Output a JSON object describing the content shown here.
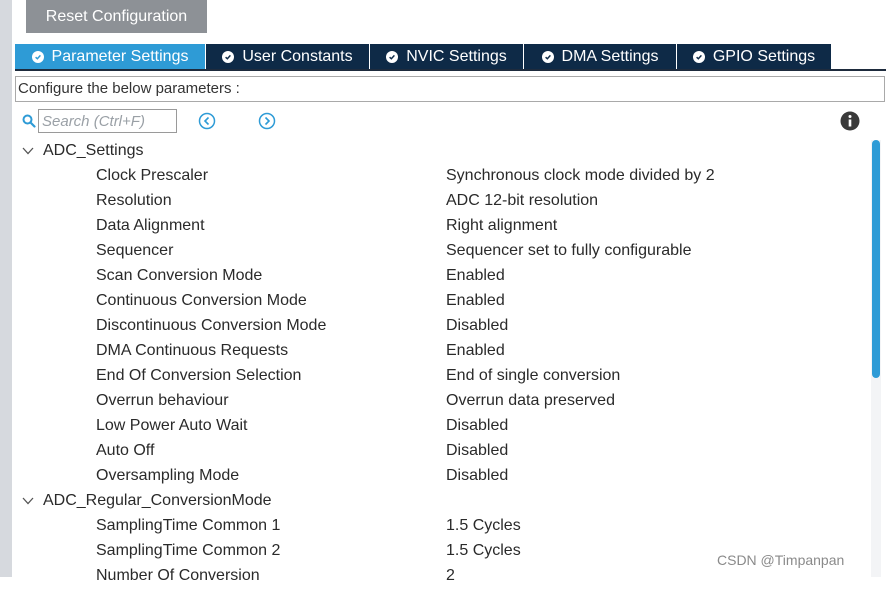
{
  "toolbar": {
    "reset_label": "Reset Configuration"
  },
  "tabs": [
    {
      "label": "Parameter Settings",
      "active": true
    },
    {
      "label": "User Constants",
      "active": false
    },
    {
      "label": "NVIC Settings",
      "active": false
    },
    {
      "label": "DMA Settings",
      "active": false
    },
    {
      "label": "GPIO Settings",
      "active": false
    }
  ],
  "caption": "Configure the below parameters :",
  "search": {
    "placeholder": "Search (Ctrl+F)"
  },
  "groups": [
    {
      "label": "ADC_Settings",
      "params": [
        {
          "name": "Clock Prescaler",
          "value": "Synchronous clock mode divided by 2"
        },
        {
          "name": "Resolution",
          "value": "ADC 12-bit resolution"
        },
        {
          "name": "Data Alignment",
          "value": "Right alignment"
        },
        {
          "name": "Sequencer",
          "value": "Sequencer set to fully configurable"
        },
        {
          "name": "Scan Conversion Mode",
          "value": "Enabled"
        },
        {
          "name": "Continuous Conversion Mode",
          "value": "Enabled"
        },
        {
          "name": "Discontinuous Conversion Mode",
          "value": "Disabled"
        },
        {
          "name": "DMA Continuous Requests",
          "value": "Enabled"
        },
        {
          "name": "End Of Conversion Selection",
          "value": "End of single conversion"
        },
        {
          "name": "Overrun behaviour",
          "value": "Overrun data preserved"
        },
        {
          "name": "Low Power Auto Wait",
          "value": "Disabled"
        },
        {
          "name": "Auto Off",
          "value": "Disabled"
        },
        {
          "name": "Oversampling Mode",
          "value": "Disabled"
        }
      ]
    },
    {
      "label": "ADC_Regular_ConversionMode",
      "params": [
        {
          "name": "SamplingTime Common 1",
          "value": "1.5 Cycles"
        },
        {
          "name": "SamplingTime Common 2",
          "value": "1.5 Cycles"
        },
        {
          "name": "Number Of Conversion",
          "value": "2"
        }
      ]
    }
  ],
  "watermark": "CSDN @Timpanpan",
  "colors": {
    "tab_active": "#2e9bd6",
    "tab_inactive": "#0e2a47",
    "button_gray": "#8d9196",
    "accent_blue": "#2e9bd6"
  },
  "icons": {
    "tab_check": "check-circle-icon",
    "search": "search-icon",
    "prev": "previous-result-icon",
    "next": "next-result-icon",
    "info": "info-icon",
    "expand": "chevron-down-icon"
  }
}
